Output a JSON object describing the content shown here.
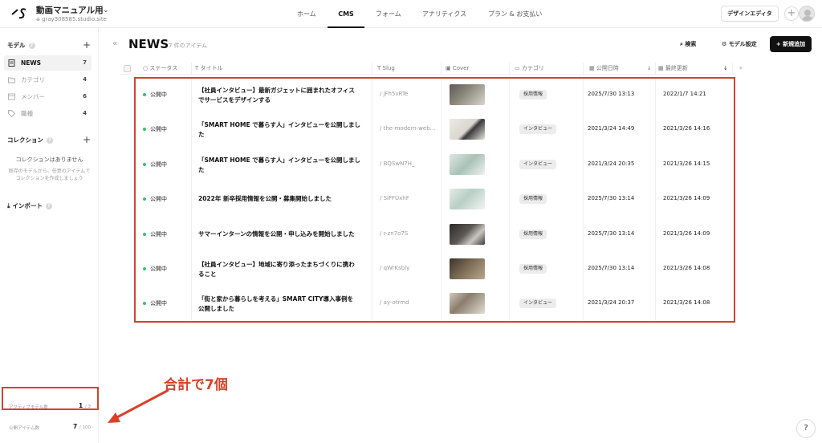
{
  "header": {
    "project_title": "動画マニュアル用",
    "site": "gray308585.studio.site",
    "nav": [
      "ホーム",
      "CMS",
      "フォーム",
      "アナリティクス",
      "プラン & お支払い"
    ],
    "design_editor": "デザインエディタ"
  },
  "sidebar": {
    "models_heading": "モデル",
    "models": [
      {
        "label": "NEWS",
        "count": "7"
      },
      {
        "label": "カテゴリ",
        "count": "4"
      },
      {
        "label": "メンバー",
        "count": "6"
      },
      {
        "label": "職種",
        "count": "4"
      }
    ],
    "collections_heading": "コレクション",
    "empty_title": "コレクションはありません",
    "empty_desc_1": "既存のモデルから、任意のアイテムで",
    "empty_desc_2": "コレクションを作成しましょう",
    "import_label": "インポート",
    "active_models_label": "アクティブモデル数",
    "active_models_value": "1",
    "active_models_total": "/ 3",
    "published_items_label": "公開アイテム数",
    "published_items_value": "7",
    "published_items_total": "/ 100"
  },
  "main": {
    "title": "NEWS",
    "item_count": "7 件のアイテム",
    "search_label": "検索",
    "model_settings_label": "モデル設定",
    "add_label": "新規追加",
    "columns": [
      "ステータス",
      "タイトル",
      "Slug",
      "Cover",
      "カテゴリ",
      "公開日時",
      "最終更新"
    ],
    "rows": [
      {
        "status": "公開中",
        "title_1": "【社員インタビュー】最新ガジェットに囲まれたオフィス",
        "title_2": "でサービスをデザインする",
        "slug": "/ jFh5vRTe",
        "category": "採用情報",
        "published": "2025/7/30 13:13",
        "updated": "2022/1/7 14:21"
      },
      {
        "status": "公開中",
        "title_1": "「SMART HOME で暮らす人」インタビューを公開しまし",
        "title_2": "た",
        "slug": "/ the-modern-web...",
        "category": "インタビュー",
        "published": "2021/3/24 14:49",
        "updated": "2021/3/26 14:16"
      },
      {
        "status": "公開中",
        "title_1": "「SMART HOME で暮らす人」インタビューを公開しまし",
        "title_2": "た",
        "slug": "/ BQSwN7H_",
        "category": "インタビュー",
        "published": "2021/3/24 20:35",
        "updated": "2021/3/26 14:15"
      },
      {
        "status": "公開中",
        "title_1": "2022年 新卒採用情報を公開・募集開始しました",
        "title_2": "",
        "slug": "/ SiFFUxhF",
        "category": "採用情報",
        "published": "2025/7/30 13:14",
        "updated": "2021/3/26 14:09"
      },
      {
        "status": "公開中",
        "title_1": "サマーインターンの情報を公開・申し込みを開始しました",
        "title_2": "",
        "slug": "/ r-zn7o7S",
        "category": "採用情報",
        "published": "2025/7/30 13:14",
        "updated": "2021/3/26 14:09"
      },
      {
        "status": "公開中",
        "title_1": "【社員インタビュー】地域に寄り添ったまちづくりに携わ",
        "title_2": "ること",
        "slug": "/ qWrKsbly",
        "category": "採用情報",
        "published": "2025/7/30 13:14",
        "updated": "2021/3/26 14:08"
      },
      {
        "status": "公開中",
        "title_1": "「街と家から暮らしを考える」SMART CITY導入事例を",
        "title_2": "公開しました",
        "slug": "/ ay-otrmd",
        "category": "インタビュー",
        "published": "2021/3/24 20:37",
        "updated": "2021/3/26 14:08"
      }
    ]
  },
  "annotation": "合計で7個",
  "colors": {
    "highlight": "#d0452b",
    "published_dot": "#39c46a"
  },
  "help": "?"
}
